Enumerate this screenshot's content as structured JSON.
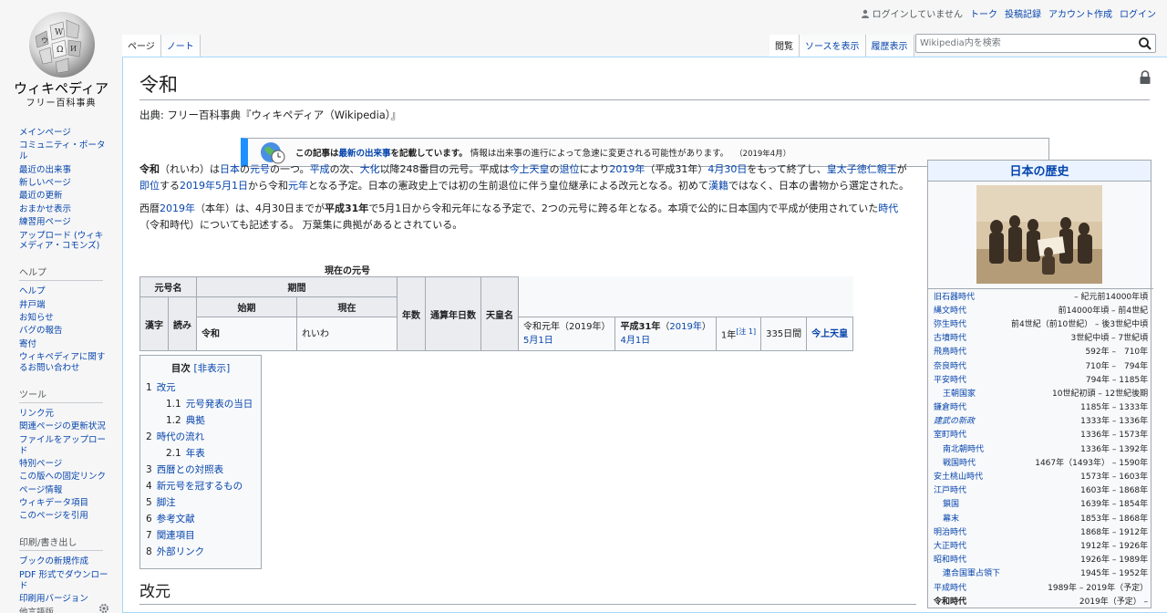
{
  "logo": {
    "wordmark": "ウィキペディア",
    "tagline": "フリー百科事典"
  },
  "personal": {
    "anon_label": "ログインしていません",
    "links": [
      "トーク",
      "投稿記録",
      "アカウント作成",
      "ログイン"
    ]
  },
  "sidebar": {
    "nav": [
      "メインページ",
      "コミュニティ・ポータル",
      "最近の出来事",
      "新しいページ",
      "最近の更新",
      "おまかせ表示",
      "練習用ページ",
      "アップロード (ウィキメディア・コモンズ)"
    ],
    "help_heading": "ヘルプ",
    "help": [
      "ヘルプ",
      "井戸端",
      "お知らせ",
      "バグの報告",
      "寄付",
      "ウィキペディアに関するお問い合わせ"
    ],
    "tools_heading": "ツール",
    "tools": [
      "リンク元",
      "関連ページの更新状況",
      "ファイルをアップロード",
      "特別ページ",
      "この版への固定リンク",
      "ページ情報",
      "ウィキデータ項目",
      "このページを引用"
    ],
    "print_heading": "印刷/書き出し",
    "print": [
      "ブックの新規作成",
      "PDF 形式でダウンロード",
      "印刷用バージョン"
    ],
    "lang_heading": "他言語版"
  },
  "tabs": {
    "left": [
      "ページ",
      "ノート"
    ],
    "right": [
      "閲覧",
      "ソースを表示",
      "履歴表示"
    ]
  },
  "search": {
    "placeholder": "Wikipedia内を検索"
  },
  "article": {
    "title": "令和",
    "site_sub": "出典: フリー百科事典『ウィキペディア（Wikipedia）』",
    "ambox": {
      "bold1": "この記事は",
      "link": "最新の出来事",
      "bold2": "を記載しています。",
      "text": "情報は出来事の進行によって急速に変更される可能性があります。",
      "date": "（2019年4月）"
    },
    "h2": "改元"
  },
  "era_table": {
    "caption": "現在の元号",
    "headers": {
      "gengo": "元号名",
      "kanji": "漢字",
      "yomi": "読み",
      "kikan": "期間",
      "shiki": "始期",
      "genzai": "現在",
      "nensu": "年数",
      "tsusan": "通算年日数",
      "tenno": "天皇名"
    },
    "row": {
      "kanji": "令和",
      "yomi": "れいわ",
      "shiki_a": "令和元年（2019年）",
      "shiki_link": "5月1日",
      "genzai_bold": "平成31年",
      "genzai_paren_open": "（",
      "genzai_link": "2019年",
      "genzai_paren_close": "）",
      "genzai_link2": "4月1日",
      "nensu": "1年",
      "nensu_note": "[注 1]",
      "tsusan": "335日間",
      "tenno": "今上天皇"
    }
  },
  "toc": {
    "title": "目次",
    "hide": "[非表示]",
    "items": [
      {
        "num": "1",
        "label": "改元",
        "sub": false
      },
      {
        "num": "1.1",
        "label": "元号発表の当日",
        "sub": true
      },
      {
        "num": "1.2",
        "label": "典拠",
        "sub": true
      },
      {
        "num": "2",
        "label": "時代の流れ",
        "sub": false
      },
      {
        "num": "2.1",
        "label": "年表",
        "sub": true
      },
      {
        "num": "3",
        "label": "西暦との対照表",
        "sub": false
      },
      {
        "num": "4",
        "label": "新元号を冠するもの",
        "sub": false
      },
      {
        "num": "5",
        "label": "脚注",
        "sub": false
      },
      {
        "num": "6",
        "label": "参考文献",
        "sub": false
      },
      {
        "num": "7",
        "label": "関連項目",
        "sub": false
      },
      {
        "num": "8",
        "label": "外部リンク",
        "sub": false
      }
    ]
  },
  "infobox": {
    "title": "日本の歴史",
    "rows": [
      {
        "name": "旧石器時代",
        "range": "– 紀元前14000年頃",
        "sub": false,
        "italic": false
      },
      {
        "name": "縄文時代",
        "range": "前14000年頃 – 前4世紀",
        "sub": false,
        "italic": false
      },
      {
        "name": "弥生時代",
        "range": "前4世紀（前10世紀） – 後3世紀中頃",
        "sub": false,
        "italic": false
      },
      {
        "name": "古墳時代",
        "range": "3世紀中頃 – 7世紀頃",
        "sub": false,
        "italic": false
      },
      {
        "name": "飛鳥時代",
        "range": "592年 –　710年",
        "sub": false,
        "italic": false
      },
      {
        "name": "奈良時代",
        "range": "710年 –　794年",
        "sub": false,
        "italic": false
      },
      {
        "name": "平安時代",
        "range": "794年 – 1185年",
        "sub": false,
        "italic": false
      },
      {
        "name": "王朝国家",
        "range": "10世紀初頭 – 12世紀後期",
        "sub": true,
        "italic": false
      },
      {
        "name": "鎌倉時代",
        "range": "1185年 – 1333年",
        "sub": false,
        "italic": false
      },
      {
        "name": "建武の新政",
        "range": "1333年 – 1336年",
        "sub": false,
        "italic": true
      },
      {
        "name": "室町時代",
        "range": "1336年 – 1573年",
        "sub": false,
        "italic": false
      },
      {
        "name": "南北朝時代",
        "range": "1336年 – 1392年",
        "sub": true,
        "italic": false
      },
      {
        "name": "戦国時代",
        "range": "1467年（1493年） – 1590年",
        "sub": true,
        "italic": false
      },
      {
        "name": "安土桃山時代",
        "range": "1573年 – 1603年",
        "sub": false,
        "italic": false
      },
      {
        "name": "江戸時代",
        "range": "1603年 – 1868年",
        "sub": false,
        "italic": false
      },
      {
        "name": "鎖国",
        "range": "1639年 – 1854年",
        "sub": true,
        "italic": false
      },
      {
        "name": "幕末",
        "range": "1853年 – 1868年",
        "sub": true,
        "italic": false
      },
      {
        "name": "明治時代",
        "range": "1868年 – 1912年",
        "sub": false,
        "italic": false
      },
      {
        "name": "大正時代",
        "range": "1912年 – 1926年",
        "sub": false,
        "italic": false
      },
      {
        "name": "昭和時代",
        "range": "1926年 – 1989年",
        "sub": false,
        "italic": false
      },
      {
        "name": "連合国軍占領下",
        "range": "1945年 – 1952年",
        "sub": true,
        "italic": false
      },
      {
        "name": "平成時代",
        "range": "1989年 – 2019年（予定）",
        "sub": false,
        "italic": false
      },
      {
        "name": "令和時代",
        "range": "2019年（予定） –",
        "sub": false,
        "italic": false,
        "current": true
      }
    ]
  },
  "colors": {
    "link": "#0645ad",
    "ambox_bar": "#1e90ff",
    "border": "#a2a9b1"
  }
}
